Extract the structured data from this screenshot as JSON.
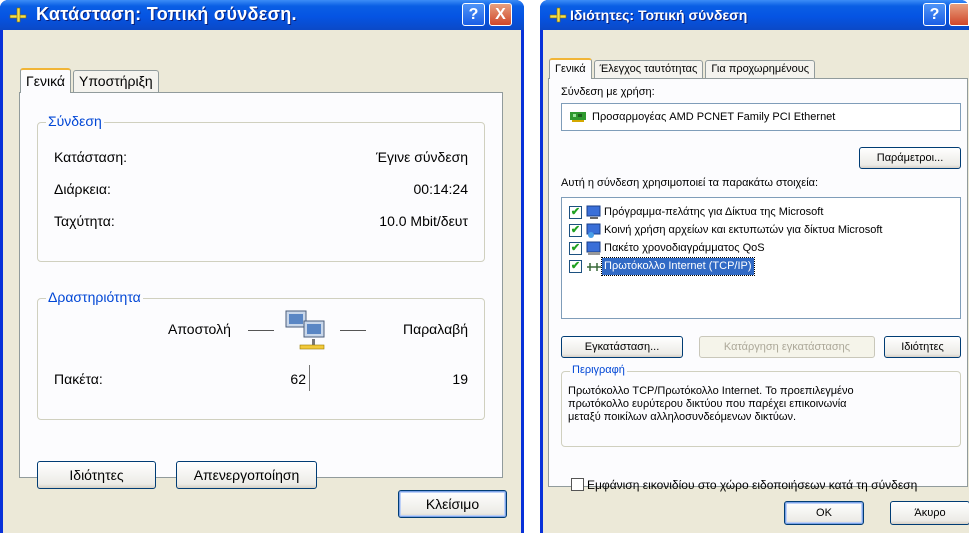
{
  "colors": {
    "titlebar": "#0554e3",
    "accent": "#0046d5",
    "face": "#ece9d8"
  },
  "status_window": {
    "title": "Κατάσταση: Τοπική σύνδεση.",
    "help": "?",
    "close": "X",
    "tabs": [
      "Γενικά",
      "Υποστήριξη"
    ],
    "connection": {
      "legend": "Σύνδεση",
      "rows": [
        {
          "label": "Κατάσταση:",
          "value": "Έγινε σύνδεση"
        },
        {
          "label": "Διάρκεια:",
          "value": "00:14:24"
        },
        {
          "label": "Ταχύτητα:",
          "value": "10.0 Mbit/δευτ"
        }
      ]
    },
    "activity": {
      "legend": "Δραστηριότητα",
      "sent": "Αποστολή",
      "received": "Παραλαβή",
      "packets_label": "Πακέτα:",
      "packets_sent": "62",
      "packets_received": "19",
      "icon": "network-activity-icon"
    },
    "properties_button": "Ιδιότητες",
    "disable_button": "Απενεργοποίηση",
    "close_button": "Κλείσιμο"
  },
  "properties_window": {
    "title": "Ιδιότητες: Τοπική σύνδεση",
    "help": "?",
    "tabs": [
      "Γενικά",
      "Έλεγχος ταυτότητας",
      "Για προχωρημένους"
    ],
    "connect_using_label": "Σύνδεση με χρήση:",
    "adapter": "Προσαρμογέας AMD PCNET Family PCI Ethernet",
    "configure_button": "Παράμετροι...",
    "items_label": "Αυτή η σύνδεση χρησιμοποιεί τα παρακάτω στοιχεία:",
    "items": [
      {
        "label": "Πρόγραμμα-πελάτης για Δίκτυα της Microsoft",
        "checked": true,
        "icon": "client-icon"
      },
      {
        "label": "Κοινή χρήση αρχείων και εκτυπωτών για δίκτυα Microsoft",
        "checked": true,
        "icon": "file-printer-sharing-icon"
      },
      {
        "label": "Πακέτο χρονοδιαγράμματος QoS",
        "checked": true,
        "icon": "qos-icon"
      },
      {
        "label": "Πρωτόκολλο Internet (TCP/IP)",
        "checked": true,
        "icon": "protocol-icon",
        "selected": true
      }
    ],
    "install_button": "Εγκατάσταση...",
    "uninstall_button": "Κατάργηση εγκατάστασης",
    "properties_button": "Ιδιότητες",
    "description_legend": "Περιγραφή",
    "description_text": [
      "Πρωτόκολλο TCP/Πρωτόκολλο Internet. Το προεπιλεγμένο",
      "πρωτόκολλο ευρύτερου δικτύου που παρέχει επικοινωνία",
      "μεταξύ ποικίλων αλληλοσυνδεόμενων δικτύων."
    ],
    "show_icon_label": "Εμφάνιση εικονιδίου στο χώρο ειδοποιήσεων κατά τη σύνδεση",
    "show_icon_checked": false,
    "ok_button": "OK",
    "cancel_button": "Άκυρο"
  }
}
